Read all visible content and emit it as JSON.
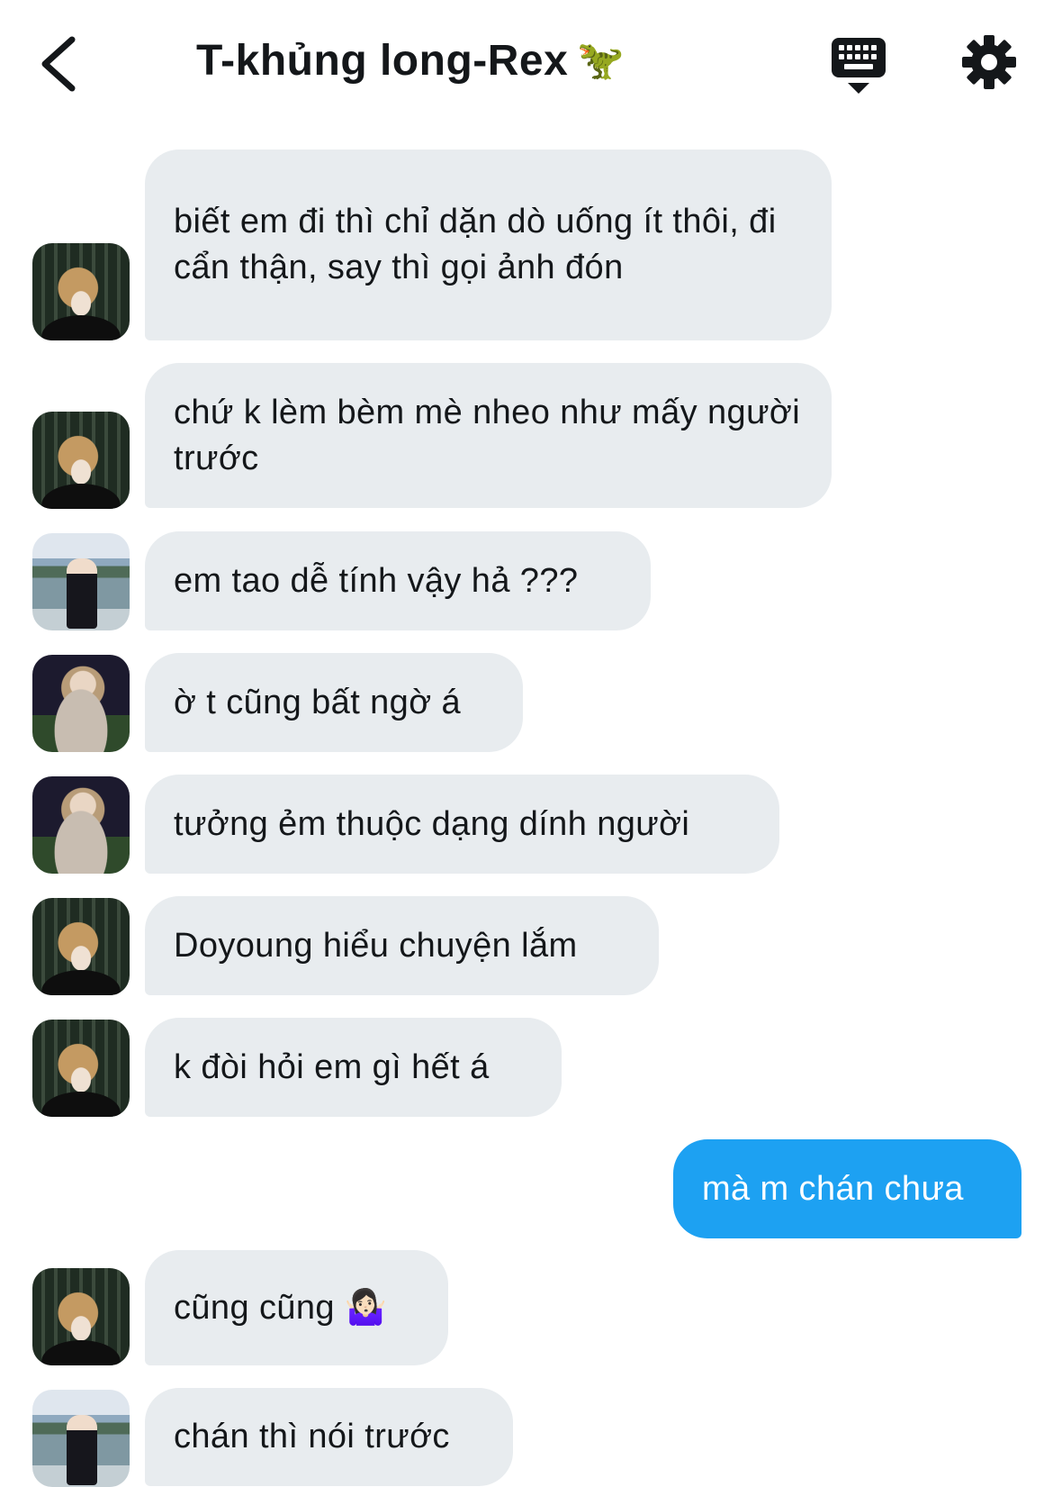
{
  "header": {
    "title": "T-khủng long-Rex",
    "title_emoji": "🦖",
    "back_icon": "chevron-left-icon",
    "keyboard_icon": "keyboard-icon",
    "settings_icon": "gear-icon"
  },
  "colors": {
    "received_bubble": "#e8ecef",
    "sent_bubble": "#1da1f2",
    "text": "#14171a"
  },
  "messages": [
    {
      "direction": "received",
      "avatar": "avatar-a",
      "text": "biết em đi thì chỉ dặn dò uống ít thôi, đi cẩn thận, say thì gọi ảnh đón"
    },
    {
      "direction": "received",
      "avatar": "avatar-a",
      "text": "chứ k lèm bèm mè nheo như mấy người trước"
    },
    {
      "direction": "received",
      "avatar": "avatar-b",
      "text": "em tao dễ tính vậy hả ???"
    },
    {
      "direction": "received",
      "avatar": "avatar-c",
      "text": "ờ t cũng bất ngờ á"
    },
    {
      "direction": "received",
      "avatar": "avatar-c",
      "text": "tưởng ẻm thuộc dạng dính người"
    },
    {
      "direction": "received",
      "avatar": "avatar-a",
      "text": "Doyoung hiểu chuyện lắm"
    },
    {
      "direction": "received",
      "avatar": "avatar-a",
      "text": "k đòi hỏi em gì hết á"
    },
    {
      "direction": "sent",
      "text": "mà m chán chưa"
    },
    {
      "direction": "received",
      "avatar": "avatar-a",
      "text": "cũng cũng 🤷🏻‍♀️"
    },
    {
      "direction": "received",
      "avatar": "avatar-b",
      "text": "chán thì nói trước"
    }
  ]
}
